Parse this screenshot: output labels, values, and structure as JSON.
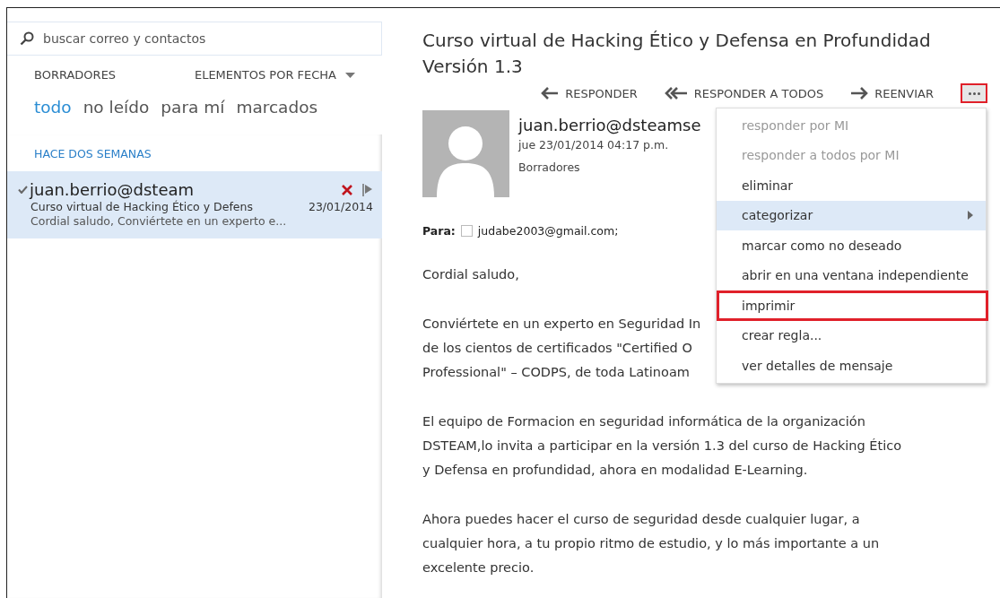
{
  "search": {
    "placeholder": "buscar correo y contactos"
  },
  "folder": "BORRADORES",
  "sort": "ELEMENTOS POR FECHA",
  "filters": [
    {
      "label": "todo",
      "selected": true
    },
    {
      "label": "no leído",
      "selected": false
    },
    {
      "label": "para mí",
      "selected": false
    },
    {
      "label": "marcados",
      "selected": false
    }
  ],
  "group": "HACE DOS SEMANAS",
  "messages": [
    {
      "sender": "juan.berrio@dsteam",
      "subject": "Curso virtual de Hacking Ético y Defens",
      "date": "23/01/2014",
      "preview": "Cordial saludo,  Conviértete en un experto e...",
      "selected": true,
      "checked": true
    }
  ],
  "reading": {
    "title": "Curso virtual de Hacking Ético y Defensa en Profundidad Versión 1.3",
    "actions": [
      {
        "kind": "reply",
        "label": "RESPONDER"
      },
      {
        "kind": "reply_all",
        "label": "RESPONDER A TODOS"
      },
      {
        "kind": "forward",
        "label": "REENVIAR"
      }
    ],
    "more_outlined": true,
    "sender": "juan.berrio@dsteamse",
    "datetime": "jue 23/01/2014 04:17 p.m.",
    "folder": "Borradores",
    "to_label": "Para:",
    "to": "judabe2003@gmail.com;",
    "to_checked": false,
    "paragraphs": [
      [
        "Cordial saludo,"
      ],
      [
        "Conviértete en un experto en Seguridad In",
        "de los cientos de certificados \"Certified O",
        "Professional\" – CODPS, de toda Latinoam"
      ],
      [
        "El equipo de Formacion en seguridad informática de la organización",
        "DSTEAM,lo invita a participar en la versión 1.3 del curso de Hacking Ético",
        "y Defensa en profundidad, ahora en modalidad E-Learning."
      ],
      [
        "Ahora puedes hacer el curso de seguridad desde cualquier lugar, a",
        "cualquier hora, a  tu propio ritmo de estudio, y lo más importante a un",
        "excelente precio."
      ]
    ]
  },
  "menu": [
    {
      "label": "responder por MI",
      "disabled": true,
      "selected": false,
      "outlined": false,
      "submenu": false
    },
    {
      "label": "responder a todos por MI",
      "disabled": true,
      "selected": false,
      "outlined": false,
      "submenu": false
    },
    {
      "label": "eliminar",
      "disabled": false,
      "selected": false,
      "outlined": false,
      "submenu": false
    },
    {
      "label": "categorizar",
      "disabled": false,
      "selected": true,
      "outlined": false,
      "submenu": true
    },
    {
      "label": "marcar como no deseado",
      "disabled": false,
      "selected": false,
      "outlined": false,
      "submenu": false
    },
    {
      "label": "abrir en una ventana independiente",
      "disabled": false,
      "selected": false,
      "outlined": false,
      "submenu": false
    },
    {
      "label": "imprimir",
      "disabled": false,
      "selected": false,
      "outlined": true,
      "submenu": false
    },
    {
      "label": "crear regla...",
      "disabled": false,
      "selected": false,
      "outlined": false,
      "submenu": false
    },
    {
      "label": "ver detalles de mensaje",
      "disabled": false,
      "selected": false,
      "outlined": false,
      "submenu": false
    }
  ]
}
